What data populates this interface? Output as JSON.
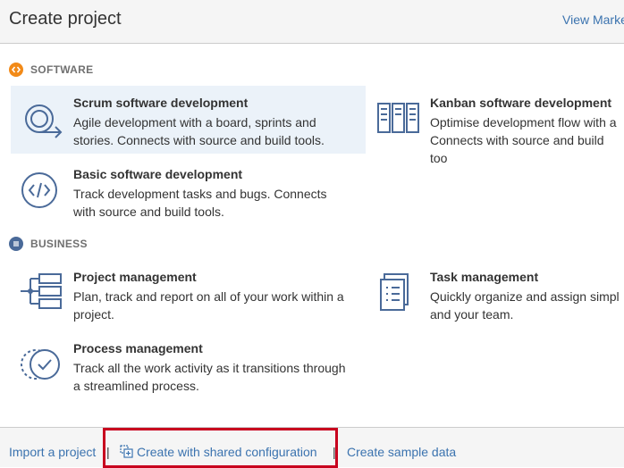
{
  "header": {
    "title": "Create project",
    "marketplace_link": "View Marke"
  },
  "sections": {
    "software": {
      "label": "SOFTWARE",
      "color": "#f28a18"
    },
    "business": {
      "label": "BUSINESS",
      "color": "#4a6a99"
    }
  },
  "templates": {
    "scrum": {
      "name": "Scrum software development",
      "description": "Agile development with a board, sprints and stories. Connects with source and build tools.",
      "icon": "scrum-icon"
    },
    "kanban": {
      "name": "Kanban software development",
      "description": "Optimise development flow with a Connects with source and build too",
      "icon": "kanban-icon"
    },
    "basic": {
      "name": "Basic software development",
      "description": "Track development tasks and bugs. Connects with source and build tools.",
      "icon": "code-icon"
    },
    "project_mgmt": {
      "name": "Project management",
      "description": "Plan, track and report on all of your work within a project.",
      "icon": "project-management-icon"
    },
    "task_mgmt": {
      "name": "Task management",
      "description": "Quickly organize and assign simpl and your team.",
      "icon": "task-management-icon"
    },
    "process_mgmt": {
      "name": "Process management",
      "description": "Track all the work activity as it transitions through a streamlined process.",
      "icon": "process-management-icon"
    }
  },
  "footer": {
    "import": "Import a project",
    "separator": "|",
    "shared_config": "Create with shared configuration",
    "sample_data": "Create sample data"
  },
  "colors": {
    "link": "#3b73af",
    "selected_bg": "#ebf2f9",
    "highlight": "#c8001e",
    "icon_blue": "#4a6a99"
  }
}
